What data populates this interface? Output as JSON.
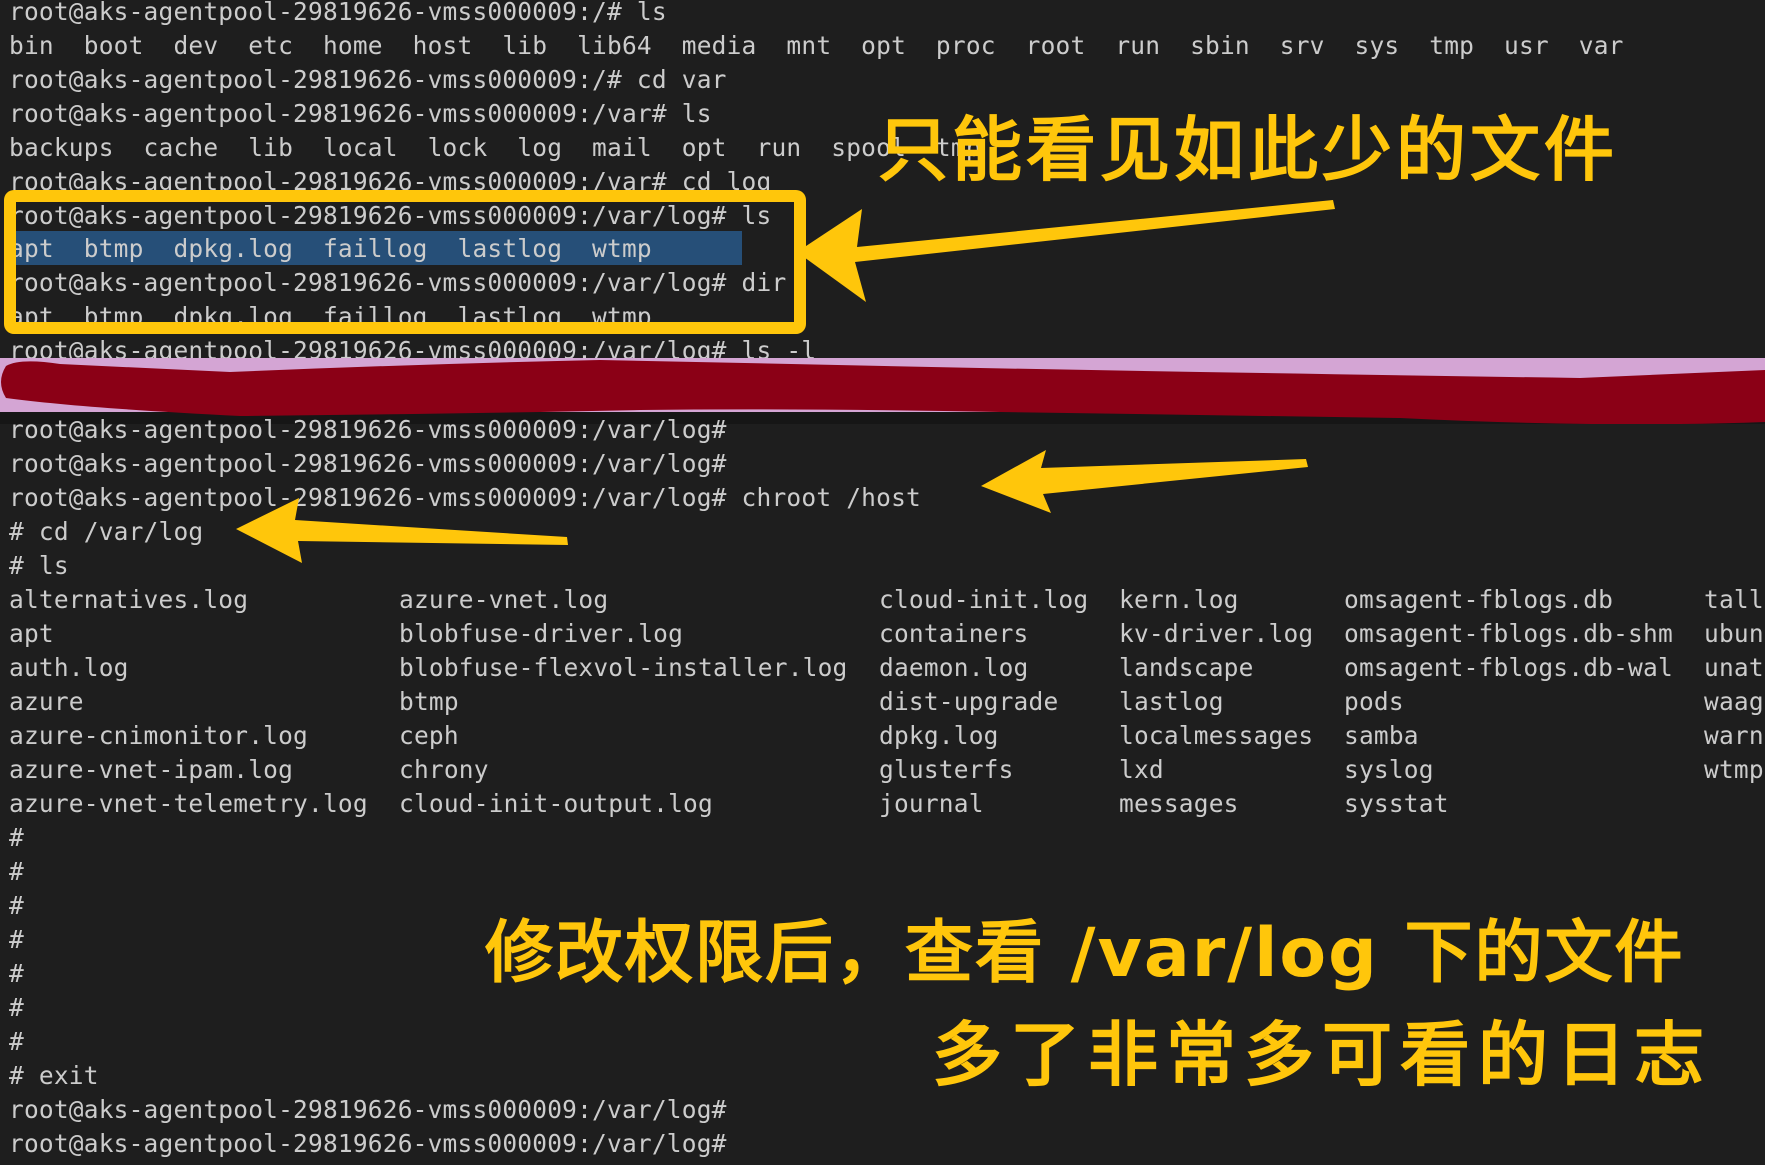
{
  "terminal": {
    "prompt_root": "root@aks-agentpool-29819626-vmss000009:/#",
    "prompt_var": "root@aks-agentpool-29819626-vmss000009:/var#",
    "prompt_varlog": "root@aks-agentpool-29819626-vmss000009:/var/log#",
    "lines": [
      "root@aks-agentpool-29819626-vmss000009:/# ls",
      "bin  boot  dev  etc  home  host  lib  lib64  media  mnt  opt  proc  root  run  sbin  srv  sys  tmp  usr  var",
      "root@aks-agentpool-29819626-vmss000009:/# cd var",
      "root@aks-agentpool-29819626-vmss000009:/var# ls",
      "backups  cache  lib  local  lock  log  mail  opt  run  spool  tmp",
      "root@aks-agentpool-29819626-vmss000009:/var# cd log",
      "root@aks-agentpool-29819626-vmss000009:/var/log# ls",
      "apt  btmp  dpkg.log  faillog  lastlog  wtmp",
      "root@aks-agentpool-29819626-vmss000009:/var/log# dir",
      "apt  btmp  dpkg.log  faillog  lastlog  wtmp",
      "root@aks-agentpool-29819626-vmss000009:/var/log# ls -l"
    ],
    "after_redaction": [
      "root@aks-agentpool-29819626-vmss000009:/var/log#",
      "root@aks-agentpool-29819626-vmss000009:/var/log#",
      "root@aks-agentpool-29819626-vmss000009:/var/log# chroot /host",
      "# cd /var/log",
      "# ls"
    ],
    "host_log_listing": [
      [
        "alternatives.log",
        "azure-vnet.log",
        "cloud-init.log",
        "kern.log",
        "omsagent-fblogs.db",
        "tall"
      ],
      [
        "apt",
        "blobfuse-driver.log",
        "containers",
        "kv-driver.log",
        "omsagent-fblogs.db-shm",
        "ubun"
      ],
      [
        "auth.log",
        "blobfuse-flexvol-installer.log",
        "daemon.log",
        "landscape",
        "omsagent-fblogs.db-wal",
        "unat"
      ],
      [
        "azure",
        "btmp",
        "dist-upgrade",
        "lastlog",
        "pods",
        "waag"
      ],
      [
        "azure-cnimonitor.log",
        "ceph",
        "dpkg.log",
        "localmessages",
        "samba",
        "warn"
      ],
      [
        "azure-vnet-ipam.log",
        "chrony",
        "glusterfs",
        "lxd",
        "syslog",
        "wtmp"
      ],
      [
        "azure-vnet-telemetry.log",
        "cloud-init-output.log",
        "journal",
        "messages",
        "sysstat",
        ""
      ]
    ],
    "tail_lines": [
      "#",
      "#",
      "#",
      "#",
      "#",
      "#",
      "#",
      "# exit",
      "root@aks-agentpool-29819626-vmss000009:/var/log#",
      "root@aks-agentpool-29819626-vmss000009:/var/log#"
    ]
  },
  "annotations": {
    "top": "只能看见如此少的文件",
    "bottom_line1": "修改权限后，查看 /var/log 下的文件",
    "bottom_line2": "多了非常多可看的日志"
  },
  "colors": {
    "background": "#1e1e1e",
    "text": "#cccccc",
    "selection": "#264f78",
    "annotation_yellow": "#ffc60b",
    "redaction_red": "#8b0016",
    "redaction_pink": "#d4a5d4"
  }
}
